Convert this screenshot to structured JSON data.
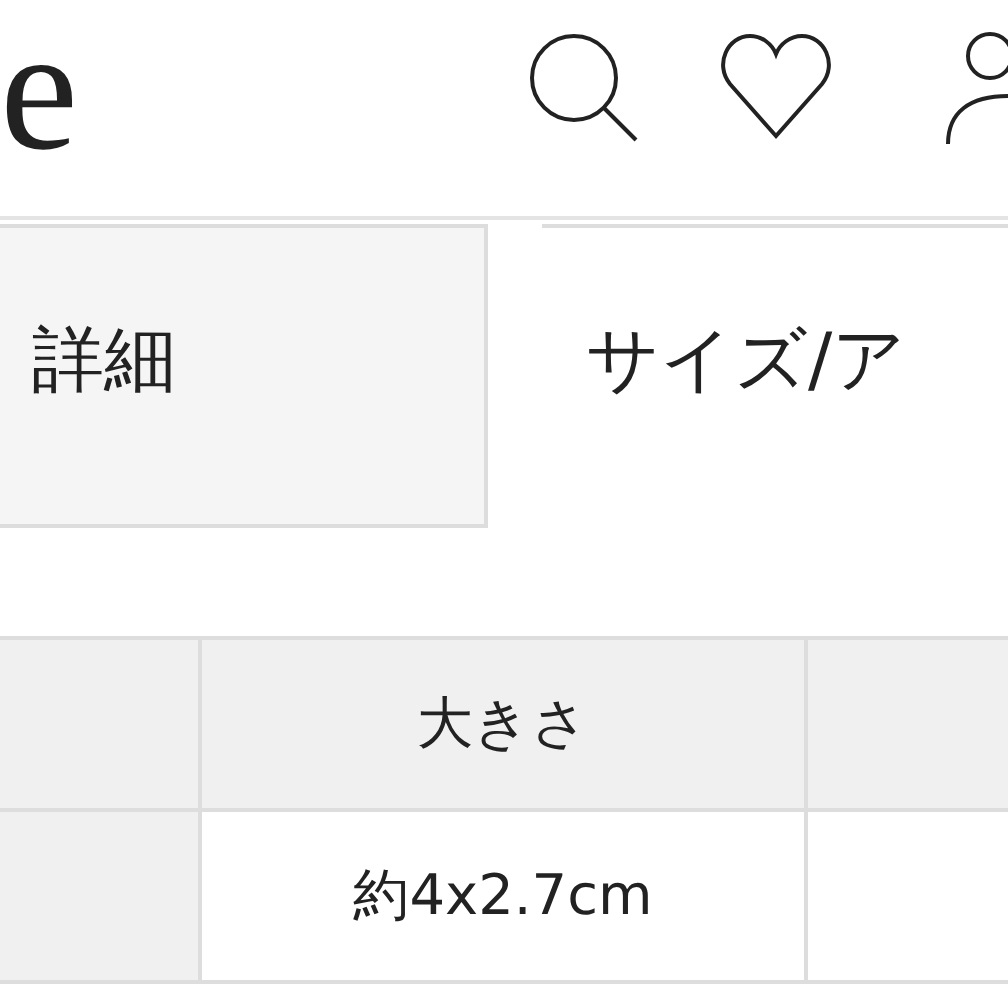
{
  "header": {
    "logo": "e"
  },
  "tabs": [
    {
      "label": "詳細",
      "selected": false
    },
    {
      "label": "サイズ/ア",
      "selected": true
    }
  ],
  "table": {
    "header": [
      "大きさ"
    ],
    "rows": [
      [
        "約4x2.7cm"
      ]
    ]
  }
}
